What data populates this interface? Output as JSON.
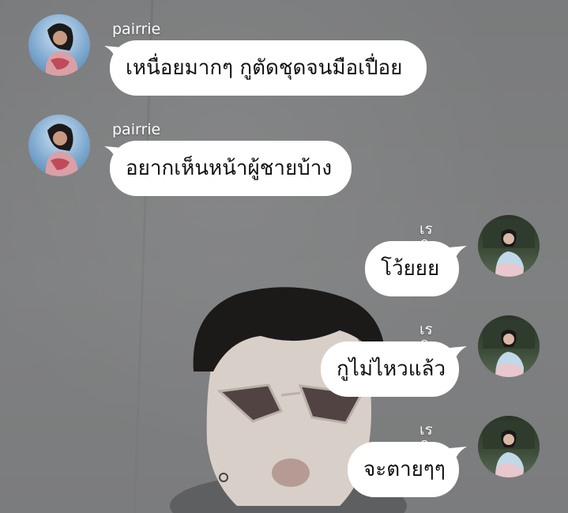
{
  "messages": [
    {
      "side": "left",
      "sender": "pairrie",
      "text": "เหนื่อยมากๆ กูตัดชุดจนมือเปื่อย"
    },
    {
      "side": "left",
      "sender": "pairrie",
      "text": "อยากเห็นหน้าผู้ชายบ้าง"
    },
    {
      "side": "right",
      "sender": "เรติน",
      "text": "โว้ยยย"
    },
    {
      "side": "right",
      "sender": "เรติน",
      "text": "กูไม่ไหวแล้ว"
    },
    {
      "side": "right",
      "sender": "เรติน",
      "text": "จะตายๆๆ"
    }
  ],
  "colors": {
    "background": "#7d7e7f",
    "bubble": "#ffffff",
    "bubble_text": "#111111",
    "name_text": "#ffffff"
  }
}
